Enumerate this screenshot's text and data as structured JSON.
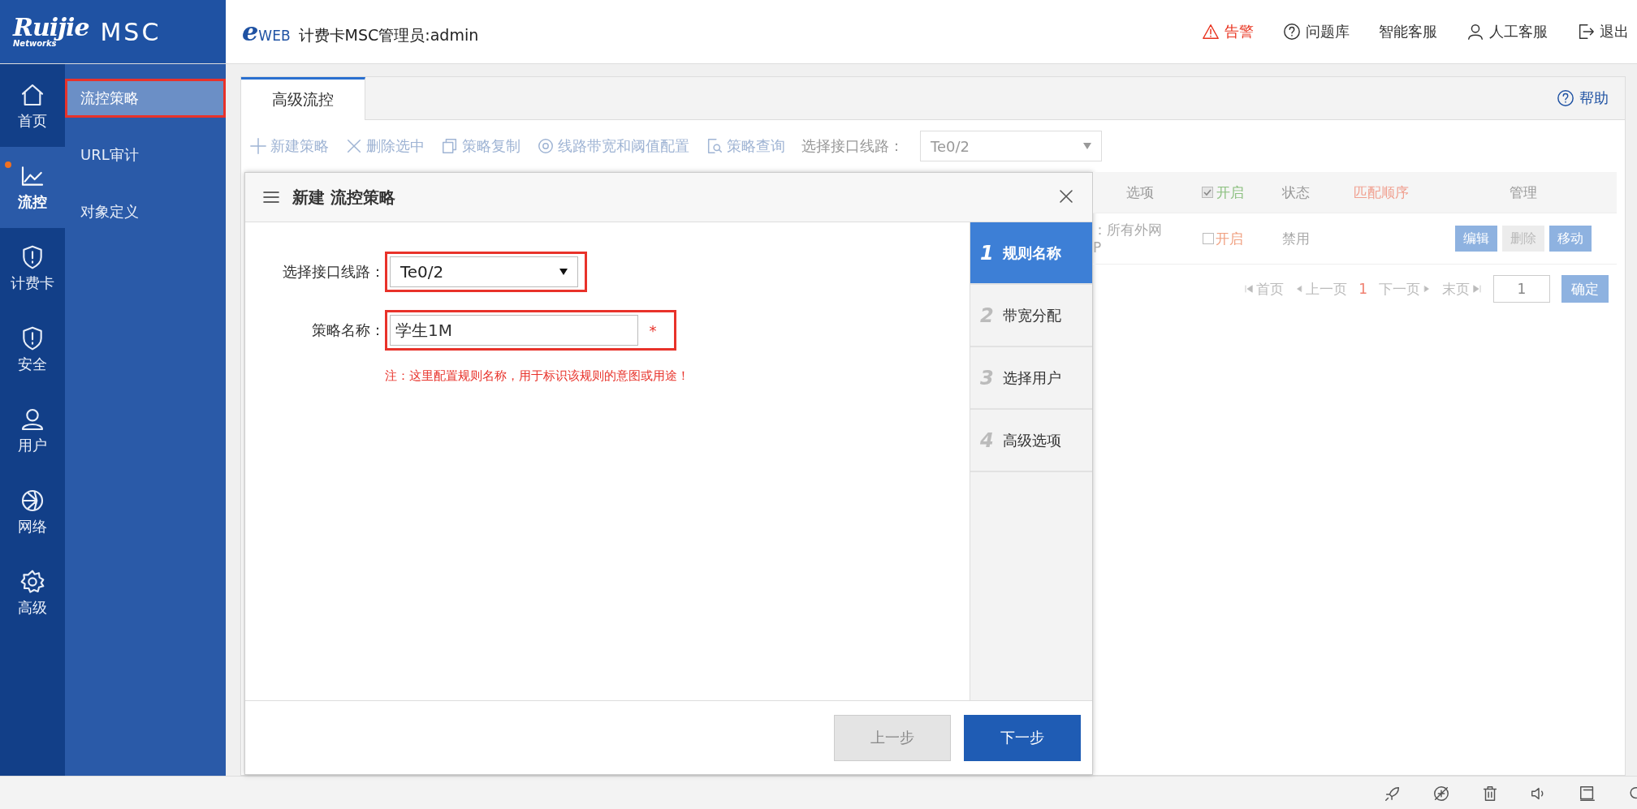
{
  "header": {
    "logo": {
      "brand": "Ruijie",
      "tagline": "Networks",
      "product": "MSC"
    },
    "app_logo": {
      "mark": "e",
      "text": "WEB"
    },
    "title": "计费卡MSC管理员:admin",
    "actions": [
      {
        "label": "告警",
        "kind": "alarm"
      },
      {
        "label": "问题库",
        "kind": "help"
      },
      {
        "label": "智能客服",
        "kind": "plain"
      },
      {
        "label": "人工客服",
        "kind": "person"
      },
      {
        "label": "退出",
        "kind": "exit"
      }
    ]
  },
  "nav": [
    {
      "label": "首页",
      "kind": "home",
      "selected": false,
      "notify": false
    },
    {
      "label": "流控",
      "kind": "chart",
      "selected": true,
      "notify": true
    },
    {
      "label": "计费卡",
      "kind": "shield",
      "selected": false,
      "notify": false
    },
    {
      "label": "安全",
      "kind": "shield",
      "selected": false,
      "notify": false
    },
    {
      "label": "用户",
      "kind": "user",
      "selected": false,
      "notify": false
    },
    {
      "label": "网络",
      "kind": "globe",
      "selected": false,
      "notify": false
    },
    {
      "label": "高级",
      "kind": "gear",
      "selected": false,
      "notify": false
    }
  ],
  "subnav": [
    {
      "label": "流控策略",
      "selected": true,
      "highlighted": true
    },
    {
      "label": "URL审计",
      "selected": false,
      "highlighted": false
    },
    {
      "label": "对象定义",
      "selected": false,
      "highlighted": false
    }
  ],
  "tabs": [
    {
      "label": "高级流控",
      "selected": true
    }
  ],
  "help": "帮助",
  "toolbar": {
    "actions": [
      {
        "label": "新建策略",
        "kind": "plus"
      },
      {
        "label": "删除选中",
        "kind": "x"
      },
      {
        "label": "策略复制",
        "kind": "copy"
      },
      {
        "label": "线路带宽和阈值配置",
        "kind": "gear"
      },
      {
        "label": "策略查询",
        "kind": "search"
      }
    ],
    "line_label": "选择接口线路：",
    "line_value": "Te0/2"
  },
  "table": {
    "columns": [
      {
        "label": "选项",
        "kind": "text"
      },
      {
        "label": "开启",
        "kind": "check",
        "checked": true
      },
      {
        "label": "状态",
        "kind": "text"
      },
      {
        "label": "匹配顺序",
        "kind": "accent"
      },
      {
        "label": "管理",
        "kind": "text"
      }
    ],
    "rows": [
      {
        "option": "：所有外网",
        "option_2": "P",
        "enabled_label": "开启",
        "enabled": false,
        "status": "禁用",
        "actions": [
          {
            "label": "编辑",
            "disabled": false
          },
          {
            "label": "删除",
            "disabled": true
          },
          {
            "label": "移动",
            "disabled": false
          }
        ]
      }
    ]
  },
  "pager": {
    "first": "首页",
    "prev": "上一页",
    "page": "1",
    "next": "下一页",
    "last": "末页",
    "input": "1",
    "go": "确定"
  },
  "dialog": {
    "title": "新建 流控策略",
    "fields": [
      {
        "label": "选择接口线路：",
        "kind": "select",
        "value": "Te0/2",
        "highlighted": true
      },
      {
        "label": "策略名称：",
        "kind": "text",
        "value": "学生1M",
        "required_mark": "*",
        "highlighted": true
      }
    ],
    "note": "注：这里配置规则名称，用于标识该规则的意图或用途！",
    "steps": [
      {
        "number": "1",
        "label": "规则名称",
        "selected": true
      },
      {
        "number": "2",
        "label": "带宽分配",
        "selected": false
      },
      {
        "number": "3",
        "label": "选择用户",
        "selected": false
      },
      {
        "number": "4",
        "label": "高级选项",
        "selected": false
      }
    ],
    "buttons": [
      {
        "label": "上一步",
        "kind": "secondary"
      },
      {
        "label": "下一步",
        "kind": "primary"
      }
    ]
  }
}
